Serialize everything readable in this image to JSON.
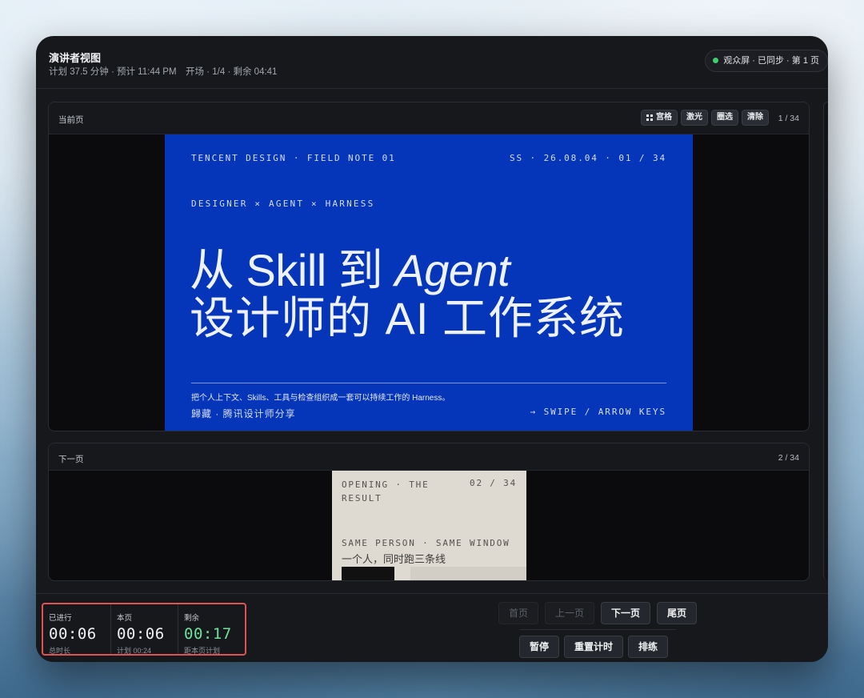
{
  "header": {
    "title": "演讲者视图",
    "subtitle": "计划 37.5 分钟 · 预计 11:44 PM　开场 · 1/4 · 剩余 04:41",
    "sync_status": "观众屏 · 已同步 · 第 1 页",
    "sync_color": "#3ccf6e"
  },
  "current": {
    "label": "当前页",
    "count": "1 / 34",
    "tools": {
      "grid": "宫格",
      "laser": "激光",
      "circle": "圈选",
      "clear": "清除"
    },
    "slide": {
      "top_left": "TENCENT DESIGN · FIELD NOTE 01",
      "top_right": "SS · 26.08.04 · 01 / 34",
      "tag": "DESIGNER × AGENT × HARNESS",
      "title_a": "从 Skill 到 ",
      "title_b": "Agent",
      "title_line2": "设计师的 AI 工作系统",
      "description": "把个人上下文、Skills、工具与检查组织成一套可以持续工作的 Harness。",
      "author": "歸藏 · 腾讯设计师分享",
      "hint": "→ SWIPE / ARROW KEYS",
      "bg_color": "#0535b9"
    }
  },
  "next": {
    "label": "下一页",
    "count": "2 / 34",
    "slide": {
      "top_left": "OPENING · THE RESULT",
      "top_right": "02 / 34",
      "meta": "SAME PERSON · SAME WINDOW",
      "title": "一个人，同时跑三条线"
    }
  },
  "timers": {
    "elapsed": {
      "label": "已进行",
      "value": "00:06",
      "sub": "总时长"
    },
    "page": {
      "label": "本页",
      "value": "00:06",
      "sub": "计划 00:24"
    },
    "remaining": {
      "label": "剩余",
      "value": "00:17",
      "sub": "距本页计划",
      "color": "#6ee39a"
    }
  },
  "controls": {
    "first": "首页",
    "prev": "上一页",
    "next": "下一页",
    "last": "尾页",
    "pause": "暂停",
    "reset": "重置计时",
    "rehearse": "排练"
  }
}
